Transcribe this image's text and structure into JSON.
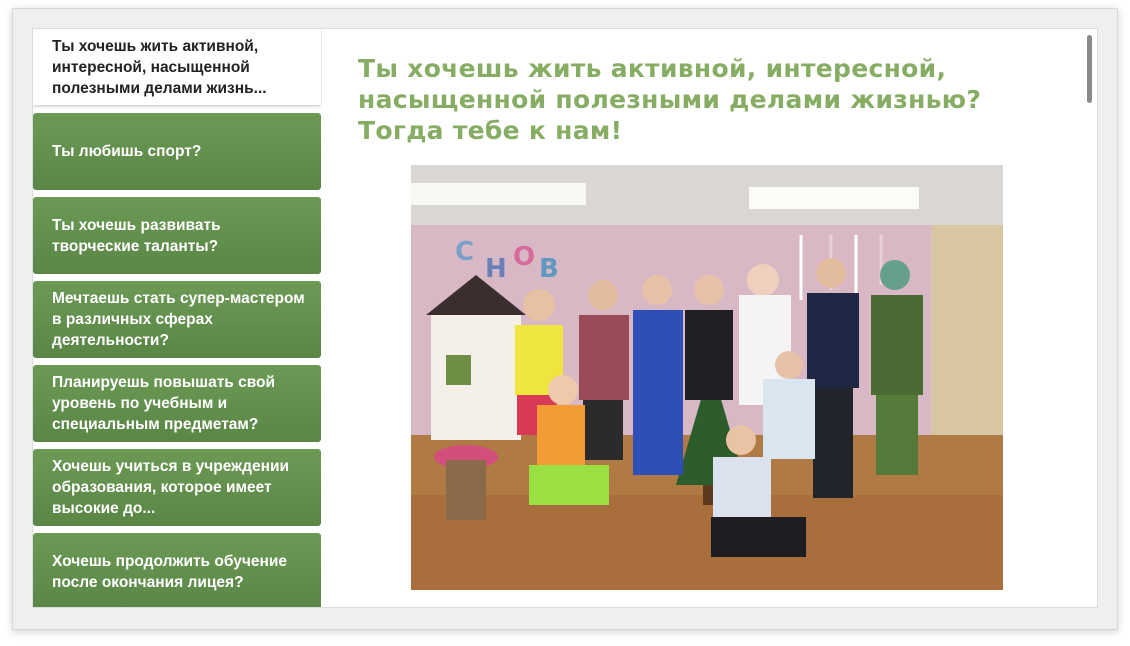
{
  "sidebar": {
    "items": [
      {
        "label": "Ты хочешь жить активной, интересной, насыщенной полезными делами жизнь..."
      },
      {
        "label": "Ты любишь спорт?"
      },
      {
        "label": "Ты хочешь развивать творческие таланты?"
      },
      {
        "label": "Мечтаешь стать супер-мастером в различных сферах деятельности?"
      },
      {
        "label": "Планируешь повышать свой уровень по учебным и специальным предметам?"
      },
      {
        "label": "Хочешь учиться в учреждении образования, которое имеет высокие до..."
      },
      {
        "label": "Хочешь продолжить обучение после окончания лицея?"
      }
    ]
  },
  "main": {
    "headline": "Ты хочешь жить активной, интересной, насыщенной полезными делами жизнью? Тогда тебе к нам!"
  },
  "colors": {
    "accent_green": "#86ad63",
    "nav_green": "#5f8b4a"
  }
}
